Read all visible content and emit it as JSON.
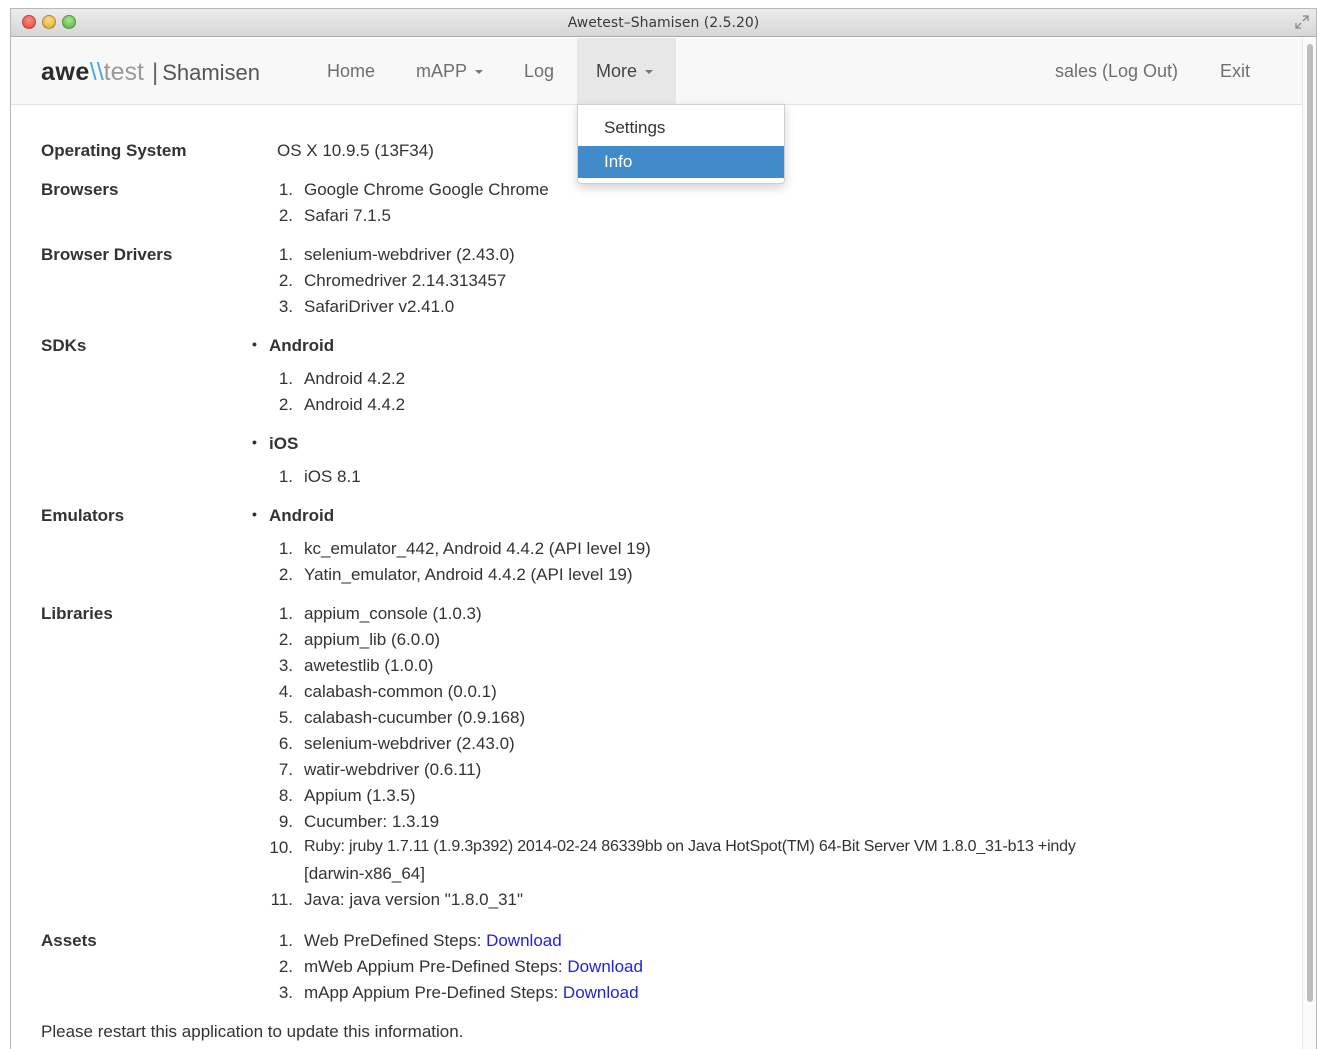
{
  "window": {
    "title": "Awetest–Shamisen (2.5.20)"
  },
  "brand": {
    "awe": "awe",
    "slash": "\\\\",
    "test": "test",
    "separator": "|",
    "app": "Shamisen"
  },
  "nav": {
    "home": "Home",
    "mapp": "mAPP",
    "log": "Log",
    "more": "More",
    "user": "sales (Log Out)",
    "exit": "Exit"
  },
  "more_menu": {
    "items": [
      "Settings",
      "Info"
    ],
    "selected": "Info"
  },
  "info": {
    "os": {
      "label": "Operating System",
      "value": "OS X 10.9.5 (13F34)"
    },
    "browsers": {
      "label": "Browsers",
      "items": [
        "Google Chrome Google Chrome",
        "Safari 7.1.5"
      ]
    },
    "drivers": {
      "label": "Browser Drivers",
      "items": [
        "selenium-webdriver (2.43.0)",
        "Chromedriver 2.14.313457",
        "SafariDriver v2.41.0"
      ]
    },
    "sdks": {
      "label": "SDKs",
      "android": {
        "name": "Android",
        "items": [
          "Android 4.2.2",
          "Android 4.4.2"
        ]
      },
      "ios": {
        "name": "iOS",
        "items": [
          "iOS 8.1"
        ]
      }
    },
    "emulators": {
      "label": "Emulators",
      "android": {
        "name": "Android",
        "items": [
          "kc_emulator_442, Android 4.4.2 (API level 19)",
          "Yatin_emulator, Android 4.4.2 (API level 19)"
        ]
      }
    },
    "libraries": {
      "label": "Libraries",
      "items": [
        "appium_console (1.0.3)",
        "appium_lib (6.0.0)",
        "awetestlib (1.0.0)",
        "calabash-common (0.0.1)",
        "calabash-cucumber (0.9.168)",
        "selenium-webdriver (2.43.0)",
        "watir-webdriver (0.6.11)",
        "Appium (1.3.5)",
        "Cucumber: 1.3.19",
        "Ruby: jruby 1.7.11 (1.9.3p392) 2014-02-24 86339bb on Java HotSpot(TM) 64-Bit Server VM 1.8.0_31-b13 +indy",
        "Java: java version \"1.8.0_31\""
      ],
      "item10_continuation": "[darwin-x86_64]"
    },
    "assets": {
      "label": "Assets",
      "items": [
        {
          "text": "Web PreDefined Steps:",
          "link": "Download"
        },
        {
          "text": "mWeb Appium Pre-Defined Steps:",
          "link": "Download"
        },
        {
          "text": "mApp Appium Pre-Defined Steps:",
          "link": "Download"
        }
      ]
    },
    "footer": "Please restart this application to update this information."
  },
  "numbers": [
    "1.",
    "2.",
    "3.",
    "4.",
    "5.",
    "6.",
    "7.",
    "8.",
    "9.",
    "10.",
    "11."
  ],
  "colors": {
    "accent": "#428bca",
    "link": "#2222dd",
    "navbar": "#f8f8f8",
    "brand_slash": "#49a7df"
  }
}
